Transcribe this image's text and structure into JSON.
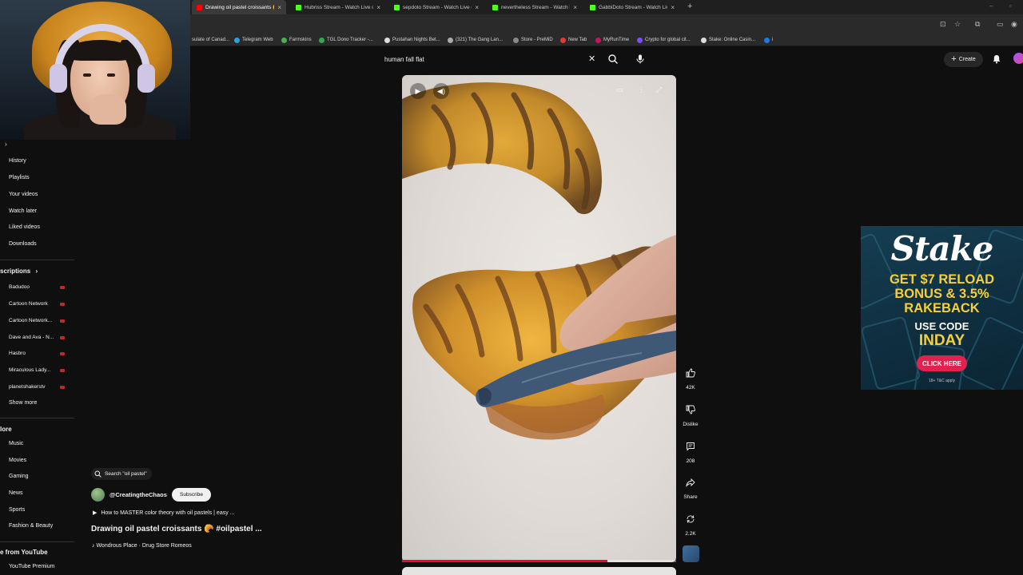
{
  "browser": {
    "tabs": [
      {
        "title": "Drawing oil pastel croissants 🥐",
        "active": true,
        "favicon_color": "#ff0000"
      },
      {
        "title": "Hubriss Stream - Watch Live o",
        "active": false,
        "favicon_color": "#53fc18"
      },
      {
        "title": "sepdoto Stream - Watch Live o",
        "active": false,
        "favicon_color": "#53fc18"
      },
      {
        "title": "nevertheless Stream - Watch Li",
        "active": false,
        "favicon_color": "#53fc18"
      },
      {
        "title": "GabbiDoto Stream - Watch Liv",
        "active": false,
        "favicon_color": "#53fc18"
      }
    ],
    "bookmarks": [
      {
        "label": "sulate of Canad...",
        "color": "#888888"
      },
      {
        "label": "Telegram Web",
        "color": "#2aa1da"
      },
      {
        "label": "Farmskins",
        "color": "#4caf50"
      },
      {
        "label": "TGL Dono Tracker -...",
        "color": "#34a853"
      },
      {
        "label": "Pustahan Nights Bet...",
        "color": "#dddddd"
      },
      {
        "label": "(321) The Gang Lan...",
        "color": "#aaaaaa"
      },
      {
        "label": "Store - PreMiD",
        "color": "#888888"
      },
      {
        "label": "New Tab",
        "color": "#e53935"
      },
      {
        "label": "MyRunTime",
        "color": "#c2185b"
      },
      {
        "label": "Crypto for global cit...",
        "color": "#7c4dff"
      },
      {
        "label": "Stake: Online Casin...",
        "color": "#dddddd"
      },
      {
        "label": "i",
        "color": "#1877f2"
      }
    ]
  },
  "search": {
    "query": "human fall flat"
  },
  "header": {
    "create_label": "Create"
  },
  "sidebar": {
    "you_items": [
      "History",
      "Playlists",
      "Your videos",
      "Watch later",
      "Liked videos",
      "Downloads"
    ],
    "subscriptions_heading": "scriptions",
    "subscriptions": [
      "Badudoo",
      "Cartoon Network",
      "Cartoon Network...",
      "Dave and Ava - N...",
      "Hasbro",
      "Miraculous Lady...",
      "planetshakerstv"
    ],
    "show_more": "Show more",
    "explore_heading": "lore",
    "explore": [
      "Music",
      "Movies",
      "Gaming",
      "News",
      "Sports",
      "Fashion & Beauty"
    ],
    "more_heading": "e from YouTube",
    "more": [
      "YouTube Premium"
    ]
  },
  "video": {
    "progress": 0.75,
    "search_chip": "Search \"oil pastel\"",
    "channel": "@CreatingtheChaos",
    "subscribe_label": "Subscribe",
    "related": "How to MASTER color theory with oil pastels | easy ...",
    "title": "Drawing oil pastel croissants 🥐 #oilpastel ...",
    "music": "Wondrous Place · Drug Store Romeos"
  },
  "actions": {
    "likes": "42K",
    "dislike": "Dislike",
    "comments": "208",
    "share": "Share",
    "remix": "2.2K"
  },
  "ad": {
    "brand": "Stake",
    "headline": [
      "GET $7 RELOAD",
      "BONUS & 3.5%",
      "RAKEBACK"
    ],
    "use_code": "USE CODE",
    "code": "INDAY",
    "cta": "CLICK HERE",
    "fine_print": "18+ T&C apply"
  },
  "colors": {
    "background": "#0f0f0f",
    "accent": "#ff0033",
    "ad_yellow": "#f6cf3b",
    "ad_cta": "#e3214f"
  }
}
